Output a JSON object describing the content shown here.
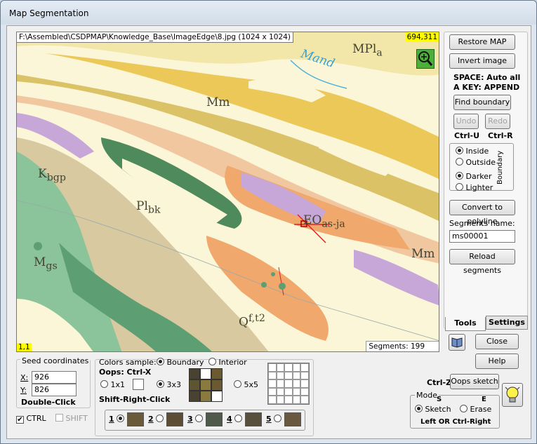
{
  "window": {
    "title": "Map Segmentation"
  },
  "map": {
    "path": "F:\\Assembled\\CSDPMAP\\Knowledge_Base\\ImageEdge\\8.jpg (1024 x 1024)",
    "cursor_coord": "694,311",
    "index": "1,1",
    "segments": "Segments: 199",
    "unit_labels": [
      "MPl",
      "a",
      "Mm",
      "K",
      "bgp",
      "Pl",
      "bk",
      "EO",
      "as-ja",
      "M",
      "gs",
      "Q",
      "f,t2",
      "Mm",
      "Mand"
    ]
  },
  "tools": {
    "restore": "Restore MAP",
    "invert": "Invert image",
    "hint1": "SPACE: Auto all",
    "hint2": "A KEY: APPEND",
    "find": "Find boundary",
    "undo": "Undo",
    "redo": "Redo",
    "undo_key": "Ctrl-U",
    "redo_key": "Ctrl-R",
    "inside": "Inside",
    "outside": "Outside",
    "darker": "Darker",
    "lighter": "Lighter",
    "boundary_label": "Boundary",
    "convert": "Convert to polyline",
    "seg_name_label": "Segments name:",
    "seg_name_value": "ms00001",
    "reload": "Reload segments",
    "tab_tools": "Tools",
    "tab_settings": "Settings",
    "close": "Close",
    "help": "Help",
    "ctrlz": "Ctrl-Z",
    "oops_sketch": "Oops sketch",
    "mode_title": "Mode",
    "mode_s": "S",
    "mode_e": "E",
    "sketch": "Sketch",
    "erase": "Erase",
    "left_hint": "Left OR Ctrl-Right"
  },
  "seed": {
    "title": "Seed coordinates",
    "x_label": "X:",
    "x_value": "926",
    "y_label": "Y:",
    "y_value": "826",
    "hint": "Double-Click",
    "ctrl": "CTRL",
    "shift": "SHIFT"
  },
  "colors": {
    "title": "Colors sample:",
    "boundary": "Boundary",
    "interior": "Interior",
    "oops": "Oops: Ctrl-X",
    "s1": "1x1",
    "s3": "3x3",
    "s5": "5x5",
    "shift_hint": "Shift-Right-Click",
    "palettes": [
      "1",
      "2",
      "3",
      "4",
      "5"
    ]
  }
}
